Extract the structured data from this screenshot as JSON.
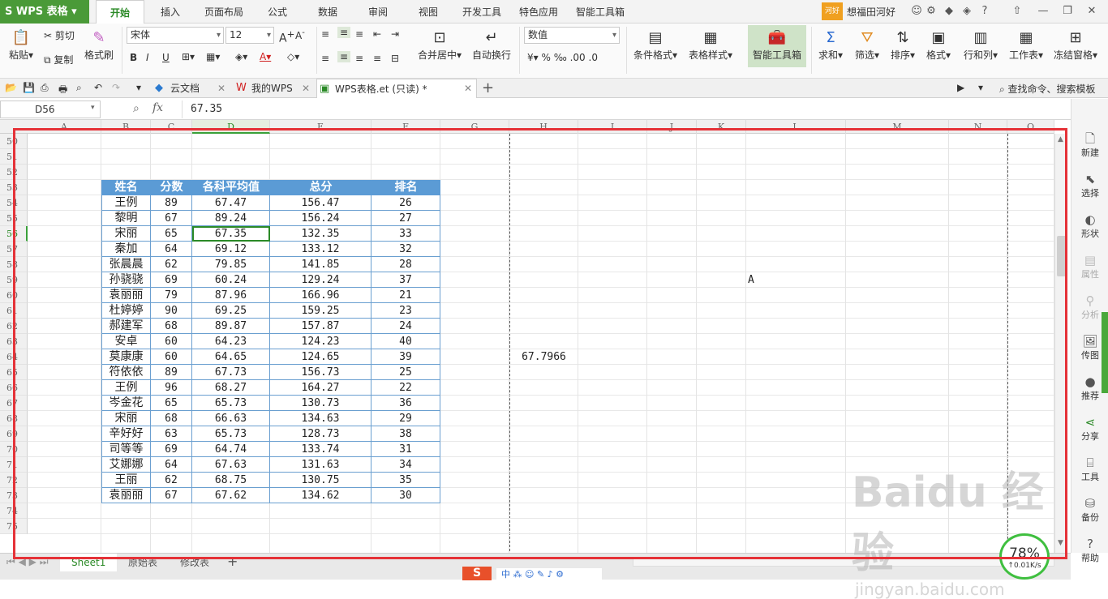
{
  "app": {
    "name": "WPS 表格",
    "user": "想福田河好",
    "badge": "河好"
  },
  "menu_tabs": [
    "开始",
    "插入",
    "页面布局",
    "公式",
    "数据",
    "审阅",
    "视图",
    "开发工具",
    "特色应用",
    "智能工具箱"
  ],
  "ribbon": {
    "paste": "粘贴",
    "cut": "剪切",
    "copy": "复制",
    "format_painter": "格式刷",
    "font_name": "宋体",
    "font_size": "12",
    "merge_center": "合并居中",
    "wrap_text": "自动换行",
    "number_format": "数值",
    "cond_format": "条件格式",
    "table_style": "表格样式",
    "smart_toolbox": "智能工具箱",
    "sum": "求和",
    "filter": "筛选",
    "sort": "排序",
    "format": "格式",
    "row_col": "行和列",
    "worksheet": "工作表",
    "freeze": "冻结窗格"
  },
  "docbar": {
    "tabs": [
      "云文档",
      "我的WPS",
      "WPS表格.et (只读) *"
    ],
    "search": "查找命令、搜索模板"
  },
  "formula": {
    "namebox": "D56",
    "fx": "fx",
    "value": "67.35"
  },
  "columns": [
    "A",
    "B",
    "C",
    "D",
    "E",
    "F",
    "G",
    "H",
    "I",
    "J",
    "K",
    "L",
    "M",
    "N",
    "O"
  ],
  "rows": [
    "50",
    "51",
    "52",
    "53",
    "54",
    "55",
    "56",
    "57",
    "58",
    "59",
    "60",
    "61",
    "62",
    "63",
    "64",
    "65",
    "66",
    "67",
    "68",
    "69",
    "70",
    "71",
    "72",
    "73",
    "74",
    "75"
  ],
  "table": {
    "headers": [
      "姓名",
      "分数",
      "各科平均值",
      "总分",
      "排名"
    ],
    "rows": [
      [
        "王例",
        "89",
        "67.47",
        "156.47",
        "26"
      ],
      [
        "黎明",
        "67",
        "89.24",
        "156.24",
        "27"
      ],
      [
        "宋丽",
        "65",
        "67.35",
        "132.35",
        "33"
      ],
      [
        "秦加",
        "64",
        "69.12",
        "133.12",
        "32"
      ],
      [
        "张晨晨",
        "62",
        "79.85",
        "141.85",
        "28"
      ],
      [
        "孙骁骁",
        "69",
        "60.24",
        "129.24",
        "37"
      ],
      [
        "袁丽丽",
        "79",
        "87.96",
        "166.96",
        "21"
      ],
      [
        "杜婷婷",
        "90",
        "69.25",
        "159.25",
        "23"
      ],
      [
        "郝建军",
        "68",
        "89.87",
        "157.87",
        "24"
      ],
      [
        "安卓",
        "60",
        "64.23",
        "124.23",
        "40"
      ],
      [
        "莫康康",
        "60",
        "64.65",
        "124.65",
        "39"
      ],
      [
        "符依依",
        "89",
        "67.73",
        "156.73",
        "25"
      ],
      [
        "王例",
        "96",
        "68.27",
        "164.27",
        "22"
      ],
      [
        "岑金花",
        "65",
        "65.73",
        "130.73",
        "36"
      ],
      [
        "宋丽",
        "68",
        "66.63",
        "134.63",
        "29"
      ],
      [
        "辛好好",
        "63",
        "65.73",
        "128.73",
        "38"
      ],
      [
        "司等等",
        "69",
        "64.74",
        "133.74",
        "31"
      ],
      [
        "艾娜娜",
        "64",
        "67.63",
        "131.63",
        "34"
      ],
      [
        "王丽",
        "62",
        "68.75",
        "130.75",
        "35"
      ],
      [
        "袁丽丽",
        "67",
        "67.62",
        "134.62",
        "30"
      ]
    ]
  },
  "extra_cells": {
    "h64": "67.7966",
    "l59": "A"
  },
  "right_panel": [
    "新建",
    "选择",
    "形状",
    "属性",
    "分析",
    "传图",
    "推荐",
    "分享",
    "工具",
    "备份",
    "帮助"
  ],
  "sheets": [
    "Sheet1",
    "原始表",
    "修改表"
  ],
  "speed": {
    "percent": "78%",
    "rate": "0.01K/s"
  },
  "watermark": {
    "brand": "Baidu 经验",
    "url": "jingyan.baidu.com"
  }
}
